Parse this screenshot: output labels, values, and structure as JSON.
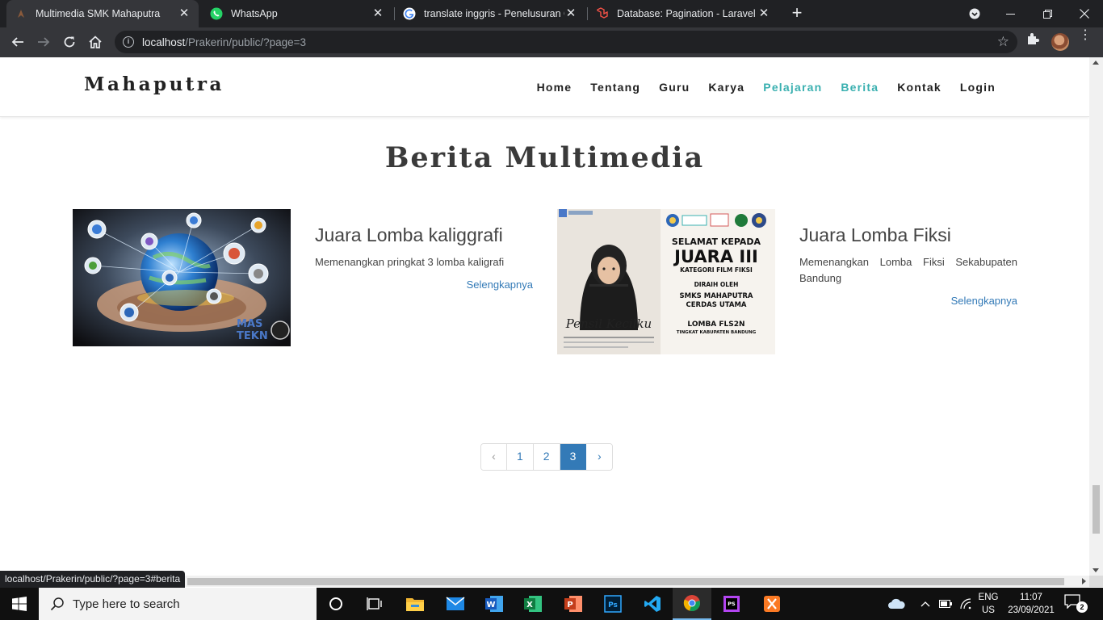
{
  "browser": {
    "tabs": [
      {
        "title": "Multimedia SMK Mahaputra",
        "active": true
      },
      {
        "title": "WhatsApp",
        "active": false
      },
      {
        "title": "translate inggris - Penelusuran Google",
        "active": false
      },
      {
        "title": "Database: Pagination - Laravel - The PHP Framework",
        "active": false
      }
    ],
    "url_host": "localhost",
    "url_path": "/Prakerin/public/?page=3",
    "status_url": "localhost/Prakerin/public/?page=3#berita"
  },
  "site": {
    "brand": "Mahaputra",
    "menu": [
      {
        "label": "Home",
        "highlight": false
      },
      {
        "label": "Tentang",
        "highlight": false
      },
      {
        "label": "Guru",
        "highlight": false
      },
      {
        "label": "Karya",
        "highlight": false
      },
      {
        "label": "Pelajaran",
        "highlight": true
      },
      {
        "label": "Berita",
        "highlight": true
      },
      {
        "label": "Kontak",
        "highlight": false
      },
      {
        "label": "Login",
        "highlight": false
      }
    ],
    "heading": "Berita Multimedia",
    "news": [
      {
        "title": "Juara Lomba kaliggrafi",
        "text": "Memenangkan pringkat 3 lomba kaligrafi",
        "more": "Selengkapnya",
        "image_watermark": "MAS TEKN"
      },
      {
        "title": "Juara Lomba Fiksi",
        "text": "Memenangkan Lomba Fiksi Sekabupaten Bandung",
        "more": "Selengkapnya",
        "poster": {
          "line1": "SELAMAT KEPADA",
          "line2": "JUARA III",
          "line3": "KATEGORI FILM FIKSI",
          "line4": "DIRAIH OLEH",
          "line5": "SMKS MAHAPUTRA CERDAS UTAMA",
          "line6": "LOMBA FLS2N",
          "line7": "TINGKAT KABUPATEN BANDUNG",
          "caption": "Pensil Kecilku"
        }
      }
    ],
    "pagination": {
      "prev": "‹",
      "pages": [
        "1",
        "2",
        "3"
      ],
      "current": "3",
      "next": "›"
    }
  },
  "taskbar": {
    "search_placeholder": "Type here to search",
    "lang_line1": "ENG",
    "lang_line2": "US",
    "time": "11:07",
    "date": "23/09/2021",
    "notification_count": "2"
  },
  "colors": {
    "accent_menu": "#3ab0b0",
    "link": "#337ab7",
    "chrome_dark": "#202124"
  }
}
